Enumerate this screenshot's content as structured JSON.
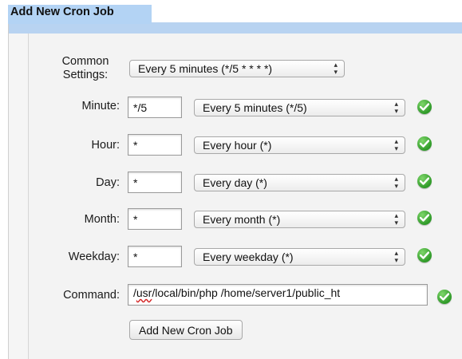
{
  "window": {
    "title": "Add New Cron Job"
  },
  "form": {
    "common_settings": {
      "label": "Common Settings:",
      "label_line1": "Common",
      "label_line2": "Settings:",
      "selected": "Every 5 minutes (*/5 * * * *)"
    },
    "rows": [
      {
        "label": "Minute:",
        "value": "*/5",
        "selected": "Every 5 minutes (*/5)",
        "valid": true
      },
      {
        "label": "Hour:",
        "value": "*",
        "selected": "Every hour (*)",
        "valid": true
      },
      {
        "label": "Day:",
        "value": "*",
        "selected": "Every day (*)",
        "valid": true
      },
      {
        "label": "Month:",
        "value": "*",
        "selected": "Every month (*)",
        "valid": true
      },
      {
        "label": "Weekday:",
        "value": "*",
        "selected": "Every weekday (*)",
        "valid": true
      }
    ],
    "command": {
      "label": "Command:",
      "value": "/usr/local/bin/php /home/server1/public_ht",
      "value_prefix": "/",
      "value_flagged": "usr",
      "value_rest": "/local/bin/php /home/server1/public_ht",
      "valid": true
    },
    "submit_label": "Add New Cron Job"
  },
  "icons": {
    "select_arrows": "up-down-arrows-icon",
    "valid": "green-check-icon"
  },
  "colors": {
    "header_band": "#b8d3f1",
    "check_green": "#2f9a28",
    "spell_error": "#d42020"
  }
}
